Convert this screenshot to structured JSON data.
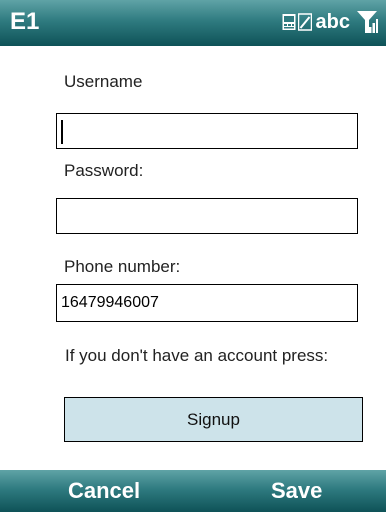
{
  "titlebar": {
    "title": "E1",
    "input_mode": "abc",
    "icons": [
      "symbol-keyboard-icon",
      "signal-icon"
    ]
  },
  "form": {
    "username_label": "Username",
    "username_value": "",
    "password_label": "Password:",
    "password_value": "",
    "phone_label": "Phone number:",
    "phone_value": "16479946007",
    "hint": "If you don't have an account press:",
    "signup_label": "Signup"
  },
  "softkeys": {
    "left": "Cancel",
    "right": "Save"
  },
  "colors": {
    "bar_top": "#5fa3a6",
    "bar_bottom": "#0e5257",
    "button_bg": "#cde3ea"
  }
}
